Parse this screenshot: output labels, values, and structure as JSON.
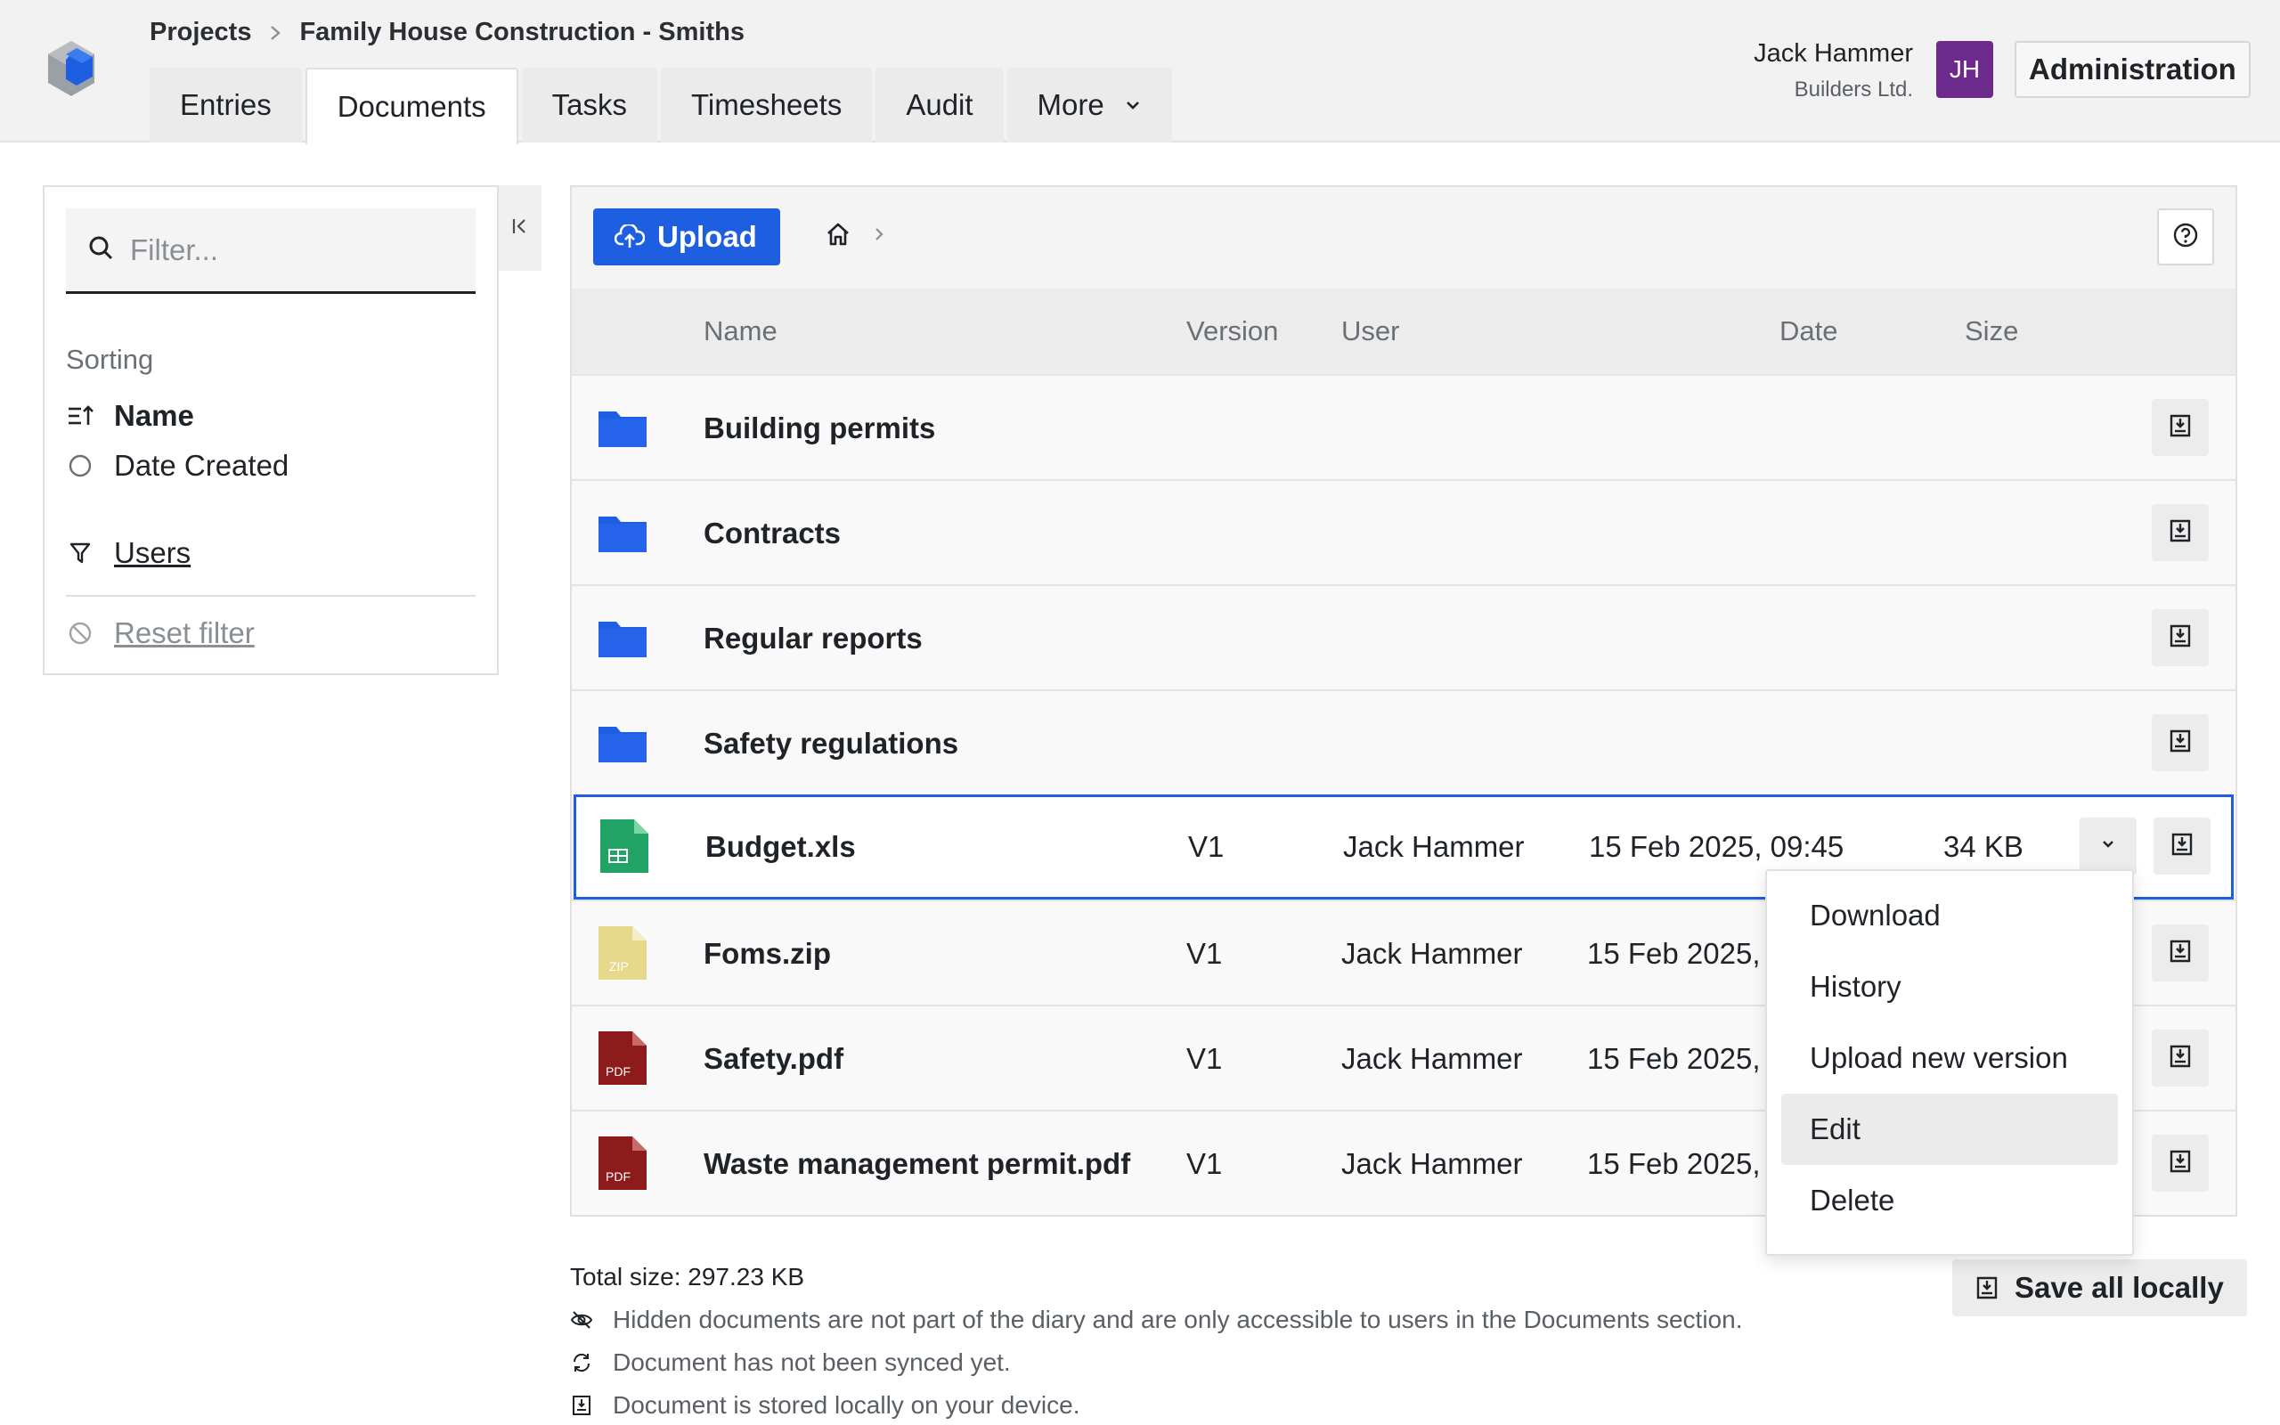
{
  "header": {
    "breadcrumb": [
      "Projects",
      "Family House Construction - Smiths"
    ],
    "tabs": [
      {
        "label": "Entries",
        "active": false
      },
      {
        "label": "Documents",
        "active": true
      },
      {
        "label": "Tasks",
        "active": false
      },
      {
        "label": "Timesheets",
        "active": false
      },
      {
        "label": "Audit",
        "active": false
      },
      {
        "label": "More",
        "active": false,
        "has_dropdown": true
      }
    ],
    "user": {
      "name": "Jack Hammer",
      "company": "Builders Ltd.",
      "initials": "JH"
    },
    "admin_label": "Administration"
  },
  "sidebar": {
    "filter_placeholder": "Filter...",
    "sorting_title": "Sorting",
    "sort_options": [
      {
        "label": "Name",
        "selected": true,
        "icon": "sort-ascending-icon"
      },
      {
        "label": "Date Created",
        "selected": false,
        "icon": "radio-icon"
      }
    ],
    "users_label": "Users",
    "reset_label": "Reset filter"
  },
  "toolbar": {
    "upload_label": "Upload"
  },
  "table": {
    "columns": [
      "Name",
      "Version",
      "User",
      "Date",
      "Size"
    ],
    "rows": [
      {
        "type": "folder",
        "name": "Building permits",
        "version": "",
        "user": "",
        "date": "",
        "size": ""
      },
      {
        "type": "folder",
        "name": "Contracts",
        "version": "",
        "user": "",
        "date": "",
        "size": ""
      },
      {
        "type": "folder",
        "name": "Regular reports",
        "version": "",
        "user": "",
        "date": "",
        "size": ""
      },
      {
        "type": "folder",
        "name": "Safety regulations",
        "version": "",
        "user": "",
        "date": "",
        "size": ""
      },
      {
        "type": "xls",
        "name": "Budget.xls",
        "version": "V1",
        "user": "Jack Hammer",
        "date": "15 Feb 2025, 09:45",
        "size": "34 KB",
        "selected": true
      },
      {
        "type": "zip",
        "name": "Foms.zip",
        "version": "V1",
        "user": "Jack Hammer",
        "date": "15 Feb 2025, (",
        "size": ""
      },
      {
        "type": "pdf",
        "name": "Safety.pdf",
        "version": "V1",
        "user": "Jack Hammer",
        "date": "15 Feb 2025, (",
        "size": ""
      },
      {
        "type": "pdf",
        "name": "Waste management permit.pdf",
        "version": "V1",
        "user": "Jack Hammer",
        "date": "15 Feb 2025, (",
        "size": ""
      }
    ],
    "file_badges": {
      "zip": "ZIP",
      "pdf": "PDF"
    }
  },
  "menu": {
    "items": [
      "Download",
      "History",
      "Upload new version",
      "Edit",
      "Delete"
    ],
    "hovered": "Edit"
  },
  "footer": {
    "total": "Total size: 297.23 KB",
    "legend": [
      {
        "icon": "eye-off-icon",
        "text": "Hidden documents are not part of the diary and are only accessible to users in the Documents section."
      },
      {
        "icon": "sync-icon",
        "text": "Document has not been synced yet."
      },
      {
        "icon": "save-local-icon",
        "text": "Document is stored locally on your device."
      }
    ],
    "save_all_label": "Save all locally"
  },
  "colors": {
    "accent": "#1d5fe0",
    "avatar": "#6c2a8d",
    "folder": "#1d5fe0",
    "xls": "#21a366",
    "zip": "#e6d98c",
    "pdf": "#8e1b1b"
  }
}
